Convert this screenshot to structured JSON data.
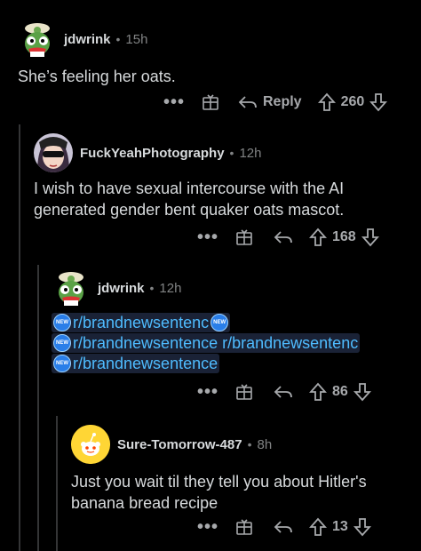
{
  "comments": [
    {
      "username": "jdwrink",
      "time": "15h",
      "body": "She’s feeling her oats.",
      "reply_label": "Reply",
      "score": "260",
      "avatar_icon": "frog-bucket-hat-avatar-icon"
    },
    {
      "username": "FuckYeahPhotography",
      "time": "12h",
      "body_lines": [
        "I wish to have sexual intercourse with the AI",
        "generated gender bent quaker oats mascot."
      ],
      "score": "168",
      "avatar_icon": "anime-sunglasses-avatar-icon"
    },
    {
      "username": "jdwrink",
      "time": "12h",
      "links": [
        "r/brandnewsentenc",
        "r/brandnewsentence r/brandnewsentenc",
        "r/brandnewsentence"
      ],
      "new_badge": "NEW",
      "score": "86",
      "avatar_icon": "frog-bucket-hat-avatar-icon"
    },
    {
      "username": "Sure-Tomorrow-487",
      "time": "8h",
      "body_lines": [
        "Just you wait til they tell you about Hitler's",
        "banana bread recipe"
      ],
      "score": "13",
      "avatar_icon": "snoo-yellow-avatar-icon"
    }
  ],
  "more_label": "•••",
  "separator": "•",
  "colors": {
    "background": "#000000",
    "text": "#d7dadc",
    "muted": "#818384",
    "link": "#4fbcff",
    "thread_line": "#343536"
  }
}
